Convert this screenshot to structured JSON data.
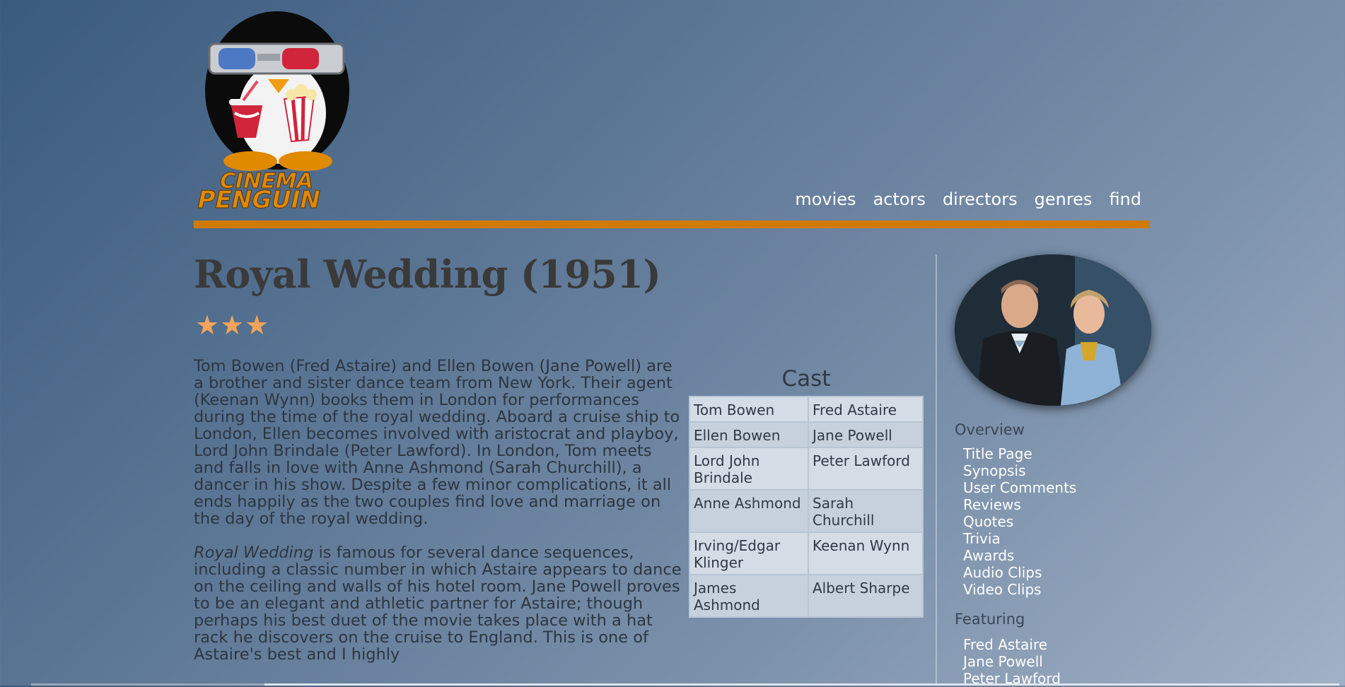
{
  "logo": {
    "text_line1": "CINEMA",
    "text_line2": "PENGUIN"
  },
  "nav": {
    "items": [
      {
        "label": "movies"
      },
      {
        "label": "actors"
      },
      {
        "label": "directors"
      },
      {
        "label": "genres"
      },
      {
        "label": "find"
      }
    ]
  },
  "movie": {
    "title": "Royal Wedding (1951)",
    "rating_stars": "★★★",
    "rating_value": 3
  },
  "synopsis": {
    "p1": "Tom Bowen (Fred Astaire) and Ellen Bowen (Jane Powell) are a brother and sister dance team from New York. Their agent (Keenan Wynn) books them in London for performances during the time of the royal wedding. Aboard a cruise ship to London, Ellen becomes involved with aristocrat and playboy, Lord John Brindale (Peter Lawford). In London, Tom meets and falls in love with Anne Ashmond (Sarah Churchill), a dancer in his show. Despite a few minor complications, it all ends happily as the two couples find love and marriage on the day of the royal wedding.",
    "p2_title_italic": "Royal Wedding",
    "p2_rest": " is famous for several dance sequences, including a classic number in which Astaire appears to dance on the ceiling and walls of his hotel room. Jane Powell proves to be an elegant and athletic partner for Astaire; though perhaps his best duet of the movie takes place with a hat rack he discovers on the cruise to England. This is one of Astaire's best and I highly"
  },
  "cast": {
    "title": "Cast",
    "rows": [
      {
        "role": "Tom Bowen",
        "actor": "Fred Astaire"
      },
      {
        "role": "Ellen Bowen",
        "actor": "Jane Powell"
      },
      {
        "role": "Lord John Brindale",
        "actor": "Peter Lawford"
      },
      {
        "role": "Anne Ashmond",
        "actor": "Sarah Churchill"
      },
      {
        "role": "Irving/Edgar Klinger",
        "actor": "Keenan Wynn"
      },
      {
        "role": "James Ashmond",
        "actor": "Albert Sharpe"
      }
    ]
  },
  "sidebar": {
    "overview_heading": "Overview",
    "overview_links": [
      {
        "label": "Title Page"
      },
      {
        "label": "Synopsis"
      },
      {
        "label": "User Comments"
      },
      {
        "label": "Reviews"
      },
      {
        "label": "Quotes"
      },
      {
        "label": "Trivia"
      },
      {
        "label": "Awards"
      },
      {
        "label": "Audio Clips"
      },
      {
        "label": "Video Clips"
      }
    ],
    "featuring_heading": "Featuring",
    "featuring_links": [
      {
        "label": "Fred Astaire"
      },
      {
        "label": "Jane Powell"
      },
      {
        "label": "Peter Lawford"
      }
    ]
  },
  "colors": {
    "accent_rule": "#d07a00",
    "star": "#f4a35a",
    "link": "#ffffff"
  }
}
